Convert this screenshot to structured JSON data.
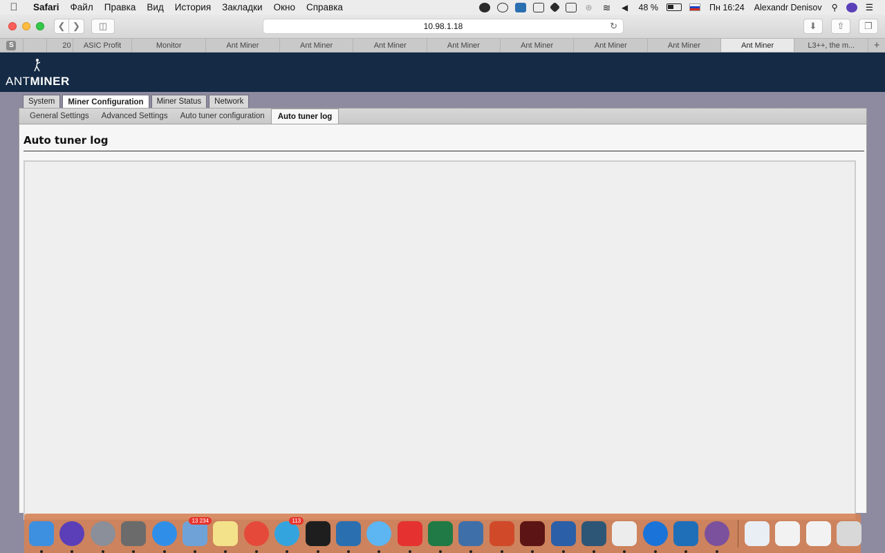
{
  "menubar": {
    "app_name": "Safari",
    "menus": [
      "Файл",
      "Правка",
      "Вид",
      "История",
      "Закладки",
      "Окно",
      "Справка"
    ],
    "battery": "48 %",
    "clock": "Пн 16:24",
    "user": "Alexandr Denisov"
  },
  "toolbar": {
    "url": "10.98.1.18"
  },
  "browser_tabs": [
    {
      "label": "20",
      "active": false
    },
    {
      "label": "ASIC Profit",
      "active": false
    },
    {
      "label": "Monitor",
      "active": false
    },
    {
      "label": "Ant Miner",
      "active": false
    },
    {
      "label": "Ant Miner",
      "active": false
    },
    {
      "label": "Ant Miner",
      "active": false
    },
    {
      "label": "Ant Miner",
      "active": false
    },
    {
      "label": "Ant Miner",
      "active": false
    },
    {
      "label": "Ant Miner",
      "active": false
    },
    {
      "label": "Ant Miner",
      "active": false
    },
    {
      "label": "Ant Miner",
      "active": true
    },
    {
      "label": "L3++, the m...",
      "active": false
    }
  ],
  "brand": {
    "logo_text_light": "ANT",
    "logo_text_bold": "MINER"
  },
  "main_tabs": [
    {
      "label": "System",
      "active": false
    },
    {
      "label": "Miner Configuration",
      "active": true
    },
    {
      "label": "Miner Status",
      "active": false
    },
    {
      "label": "Network",
      "active": false
    }
  ],
  "sub_tabs": [
    {
      "label": "General Settings",
      "active": false
    },
    {
      "label": "Advanced Settings",
      "active": false
    },
    {
      "label": "Auto tuner configuration",
      "active": false
    },
    {
      "label": "Auto tuner log",
      "active": true
    }
  ],
  "page": {
    "title": "Auto tuner log",
    "log_content": ""
  },
  "dock": {
    "items": [
      {
        "name": "finder-icon",
        "color": "#3d8fe0",
        "round": false,
        "badge": ""
      },
      {
        "name": "siri-icon",
        "color": "#5b3fb8",
        "round": true,
        "badge": ""
      },
      {
        "name": "launchpad-icon",
        "color": "#8a8f99",
        "round": true,
        "badge": ""
      },
      {
        "name": "system-preferences-icon",
        "color": "#6b6b6b",
        "round": false,
        "badge": ""
      },
      {
        "name": "safari-icon",
        "color": "#2f8fe8",
        "round": true,
        "badge": ""
      },
      {
        "name": "mail-icon",
        "color": "#6fa3d8",
        "round": false,
        "badge": "13 234"
      },
      {
        "name": "notes-icon",
        "color": "#f4e28a",
        "round": false,
        "badge": ""
      },
      {
        "name": "chrome-icon",
        "color": "#e4493a",
        "round": true,
        "badge": ""
      },
      {
        "name": "telegram-icon",
        "color": "#34a4de",
        "round": true,
        "badge": "113"
      },
      {
        "name": "terminal-icon",
        "color": "#1e1e1e",
        "round": false,
        "badge": ""
      },
      {
        "name": "remote-desktop-icon",
        "color": "#2a6fb0",
        "round": false,
        "badge": ""
      },
      {
        "name": "messages-icon",
        "color": "#5db6f2",
        "round": true,
        "badge": ""
      },
      {
        "name": "anydesk-icon",
        "color": "#e5312f",
        "round": false,
        "badge": ""
      },
      {
        "name": "excel-icon",
        "color": "#1f7a45",
        "round": false,
        "badge": ""
      },
      {
        "name": "virtualbox-icon",
        "color": "#3f6fa8",
        "round": false,
        "badge": ""
      },
      {
        "name": "powerpoint-icon",
        "color": "#d04a2a",
        "round": false,
        "badge": ""
      },
      {
        "name": "acrobat-icon",
        "color": "#5c1414",
        "round": false,
        "badge": ""
      },
      {
        "name": "word-icon",
        "color": "#2b5fa8",
        "round": false,
        "badge": ""
      },
      {
        "name": "mysql-workbench-icon",
        "color": "#2d5676",
        "round": false,
        "badge": ""
      },
      {
        "name": "textedit-icon",
        "color": "#ececec",
        "round": false,
        "badge": ""
      },
      {
        "name": "teamviewer-icon",
        "color": "#1a73d8",
        "round": true,
        "badge": ""
      },
      {
        "name": "trello-icon",
        "color": "#1f6fb8",
        "round": false,
        "badge": ""
      },
      {
        "name": "viber-icon",
        "color": "#7b519d",
        "round": true,
        "badge": ""
      }
    ],
    "right_items": [
      {
        "name": "document-stack-icon",
        "color": "#e9eef5"
      },
      {
        "name": "screenshot-thumbnail-icon",
        "color": "#f2f2f2"
      },
      {
        "name": "screenshot-thumbnail-icon-2",
        "color": "#f2f2f2"
      },
      {
        "name": "trash-icon",
        "color": "#d8d8d8"
      }
    ]
  }
}
